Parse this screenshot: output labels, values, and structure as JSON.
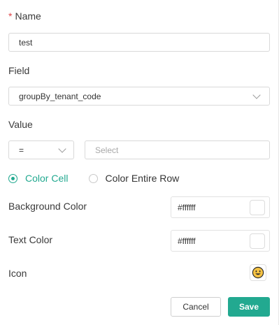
{
  "name": {
    "required_mark": "*",
    "label": "Name",
    "value": "test"
  },
  "field": {
    "label": "Field",
    "value": "groupBy_tenant_code"
  },
  "value": {
    "label": "Value",
    "operator": "=",
    "placeholder": "Select"
  },
  "apply_to": {
    "options": [
      {
        "label": "Color Cell",
        "selected": true
      },
      {
        "label": "Color Entire Row",
        "selected": false
      }
    ]
  },
  "background_color": {
    "label": "Background Color",
    "hex": "#ffffff"
  },
  "text_color": {
    "label": "Text Color",
    "hex": "#ffffff"
  },
  "icon": {
    "label": "Icon",
    "icon_name": "smiley-emoji-icon"
  },
  "buttons": {
    "cancel": "Cancel",
    "save": "Save"
  },
  "colors": {
    "accent": "#22a990",
    "required": "#e0464a",
    "border": "#d9d9d9"
  }
}
